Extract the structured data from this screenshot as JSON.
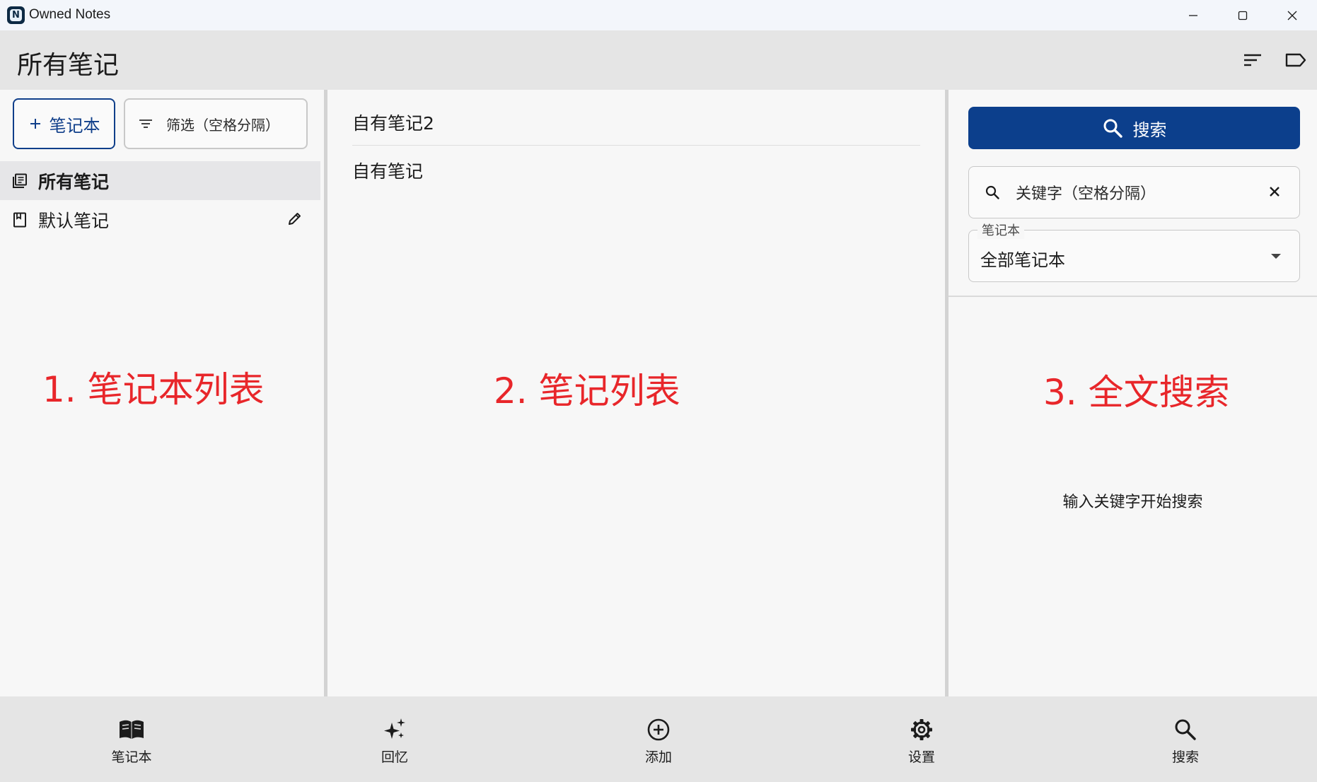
{
  "window": {
    "app_icon_letter": "N",
    "title": "Owned Notes"
  },
  "header": {
    "title": "所有笔记"
  },
  "notebooks_pane": {
    "add_notebook_label": "笔记本",
    "filter_placeholder": "筛选（空格分隔）",
    "items": [
      {
        "label": "所有笔记",
        "selected": true
      },
      {
        "label": "默认笔记",
        "selected": false
      }
    ]
  },
  "notes_pane": {
    "notes": [
      {
        "title": "自有笔记2"
      },
      {
        "title": "自有笔记"
      }
    ]
  },
  "search_pane": {
    "search_button_label": "搜索",
    "keyword_placeholder": "关键字（空格分隔）",
    "notebook_select_label": "笔记本",
    "notebook_select_value": "全部笔记本",
    "hint": "输入关键字开始搜索"
  },
  "annotations": {
    "notebook_list": "1. 笔记本列表",
    "note_list": "2. 笔记列表",
    "full_text_search": "3. 全文搜索",
    "color": "#e8262a"
  },
  "bottom_nav": {
    "items": [
      {
        "label": "笔记本",
        "icon": "book-open-icon"
      },
      {
        "label": "回忆",
        "icon": "sparkles-icon"
      },
      {
        "label": "添加",
        "icon": "add-circle-icon"
      },
      {
        "label": "设置",
        "icon": "gear-icon"
      },
      {
        "label": "搜索",
        "icon": "search-icon"
      }
    ]
  },
  "colors": {
    "primary": "#0c3f8c",
    "app_bar": "#e5e5e5",
    "background": "#f7f7f7"
  }
}
